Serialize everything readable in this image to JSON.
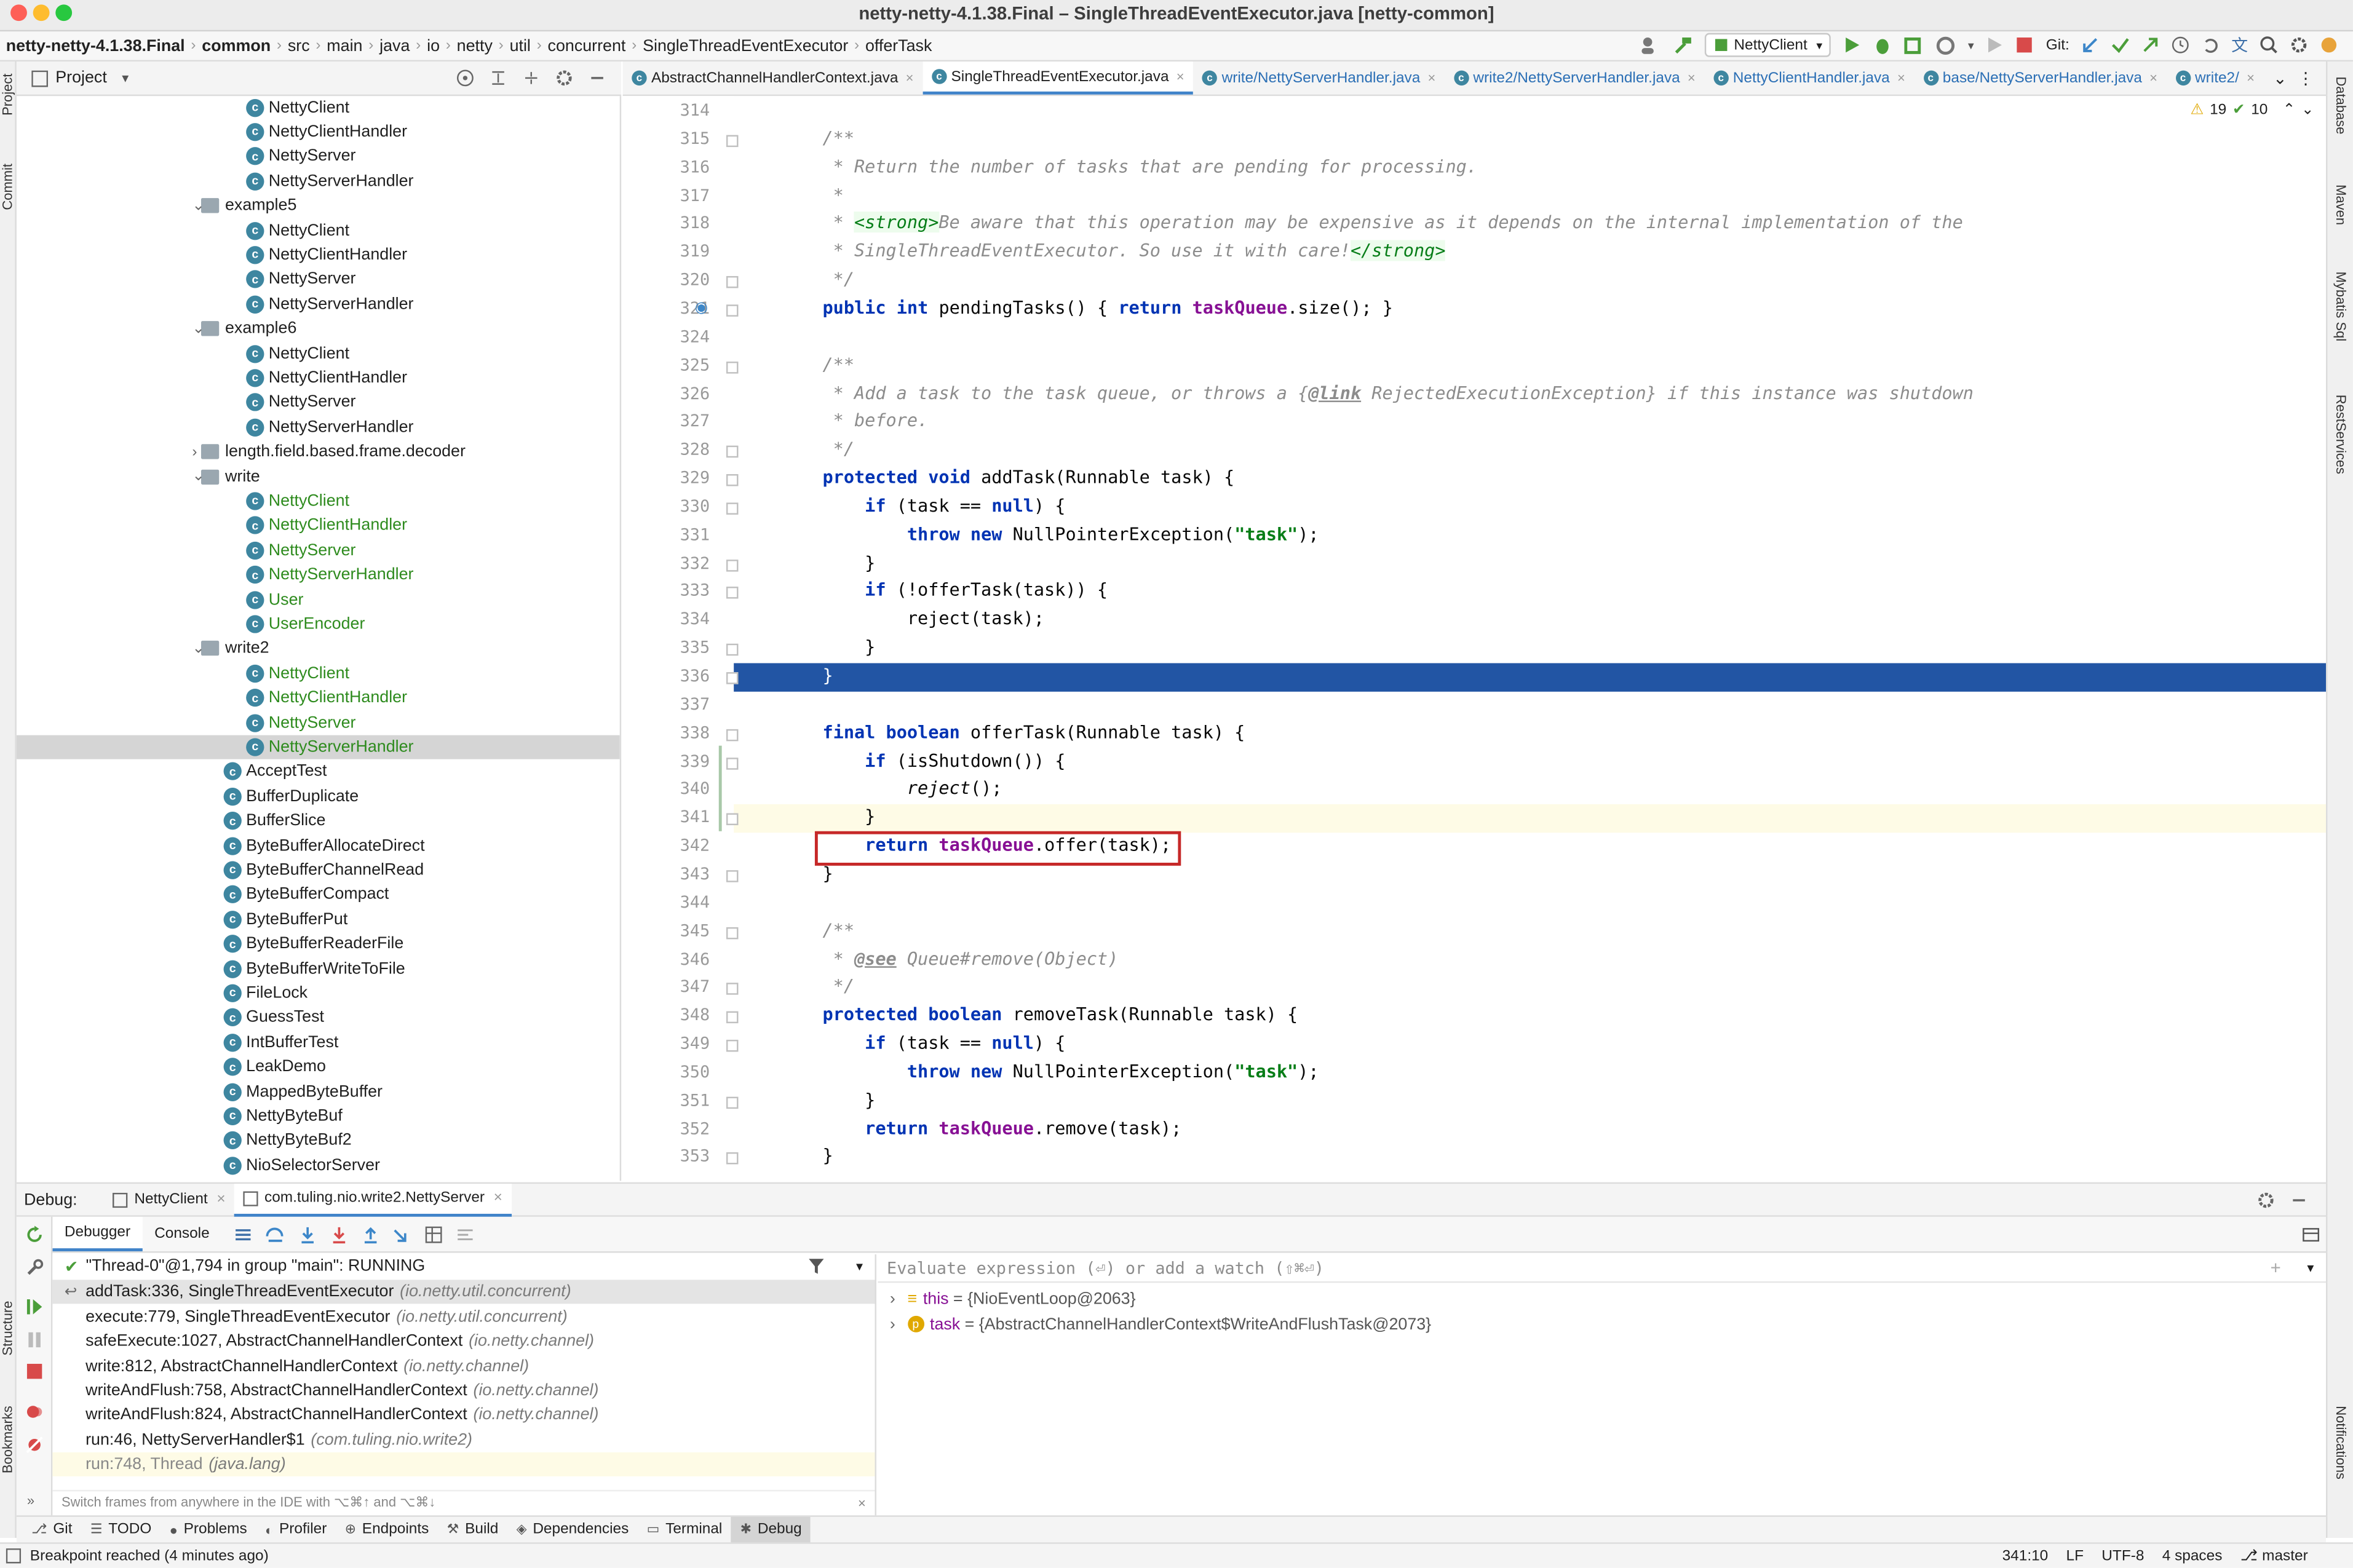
{
  "window_title": "netty-netty-4.1.38.Final – SingleThreadEventExecutor.java [netty-common]",
  "breadcrumbs": [
    "netty-netty-4.1.38.Final",
    "common",
    "src",
    "main",
    "java",
    "io",
    "netty",
    "util",
    "concurrent",
    "SingleThreadEventExecutor",
    "offerTask"
  ],
  "toolbar": {
    "run_config": "NettyClient",
    "git_label": "Git:"
  },
  "project_panel": {
    "title": "Project"
  },
  "tree": [
    {
      "label": "NettyClient",
      "level": 2,
      "kind": "class",
      "color": "normal"
    },
    {
      "label": "NettyClientHandler",
      "level": 2,
      "kind": "class",
      "color": "normal"
    },
    {
      "label": "NettyServer",
      "level": 2,
      "kind": "class",
      "color": "normal"
    },
    {
      "label": "NettyServerHandler",
      "level": 2,
      "kind": "class",
      "color": "normal"
    },
    {
      "label": "example5",
      "level": 1,
      "kind": "folder",
      "expanded": true
    },
    {
      "label": "NettyClient",
      "level": 2,
      "kind": "class",
      "color": "normal"
    },
    {
      "label": "NettyClientHandler",
      "level": 2,
      "kind": "class",
      "color": "normal"
    },
    {
      "label": "NettyServer",
      "level": 2,
      "kind": "class",
      "color": "normal"
    },
    {
      "label": "NettyServerHandler",
      "level": 2,
      "kind": "class",
      "color": "normal"
    },
    {
      "label": "example6",
      "level": 1,
      "kind": "folder",
      "expanded": true
    },
    {
      "label": "NettyClient",
      "level": 2,
      "kind": "class",
      "color": "normal"
    },
    {
      "label": "NettyClientHandler",
      "level": 2,
      "kind": "class",
      "color": "normal"
    },
    {
      "label": "NettyServer",
      "level": 2,
      "kind": "class",
      "color": "normal"
    },
    {
      "label": "NettyServerHandler",
      "level": 2,
      "kind": "class",
      "color": "normal"
    },
    {
      "label": "length.field.based.frame.decoder",
      "level": 1,
      "kind": "folder",
      "expanded": false
    },
    {
      "label": "write",
      "level": 1,
      "kind": "folder",
      "expanded": true
    },
    {
      "label": "NettyClient",
      "level": 2,
      "kind": "class",
      "color": "green"
    },
    {
      "label": "NettyClientHandler",
      "level": 2,
      "kind": "class",
      "color": "green"
    },
    {
      "label": "NettyServer",
      "level": 2,
      "kind": "class",
      "color": "green"
    },
    {
      "label": "NettyServerHandler",
      "level": 2,
      "kind": "class",
      "color": "green"
    },
    {
      "label": "User",
      "level": 2,
      "kind": "class",
      "color": "green"
    },
    {
      "label": "UserEncoder",
      "level": 2,
      "kind": "class",
      "color": "green"
    },
    {
      "label": "write2",
      "level": 1,
      "kind": "folder",
      "expanded": true
    },
    {
      "label": "NettyClient",
      "level": 2,
      "kind": "class",
      "color": "green"
    },
    {
      "label": "NettyClientHandler",
      "level": 2,
      "kind": "class",
      "color": "green"
    },
    {
      "label": "NettyServer",
      "level": 2,
      "kind": "class",
      "color": "green"
    },
    {
      "label": "NettyServerHandler",
      "level": 2,
      "kind": "class",
      "color": "green",
      "selected": true
    },
    {
      "label": "AcceptTest",
      "level": 1,
      "kind": "class",
      "color": "normal"
    },
    {
      "label": "BufferDuplicate",
      "level": 1,
      "kind": "class",
      "color": "normal"
    },
    {
      "label": "BufferSlice",
      "level": 1,
      "kind": "class",
      "color": "normal"
    },
    {
      "label": "ByteBufferAllocateDirect",
      "level": 1,
      "kind": "class",
      "color": "normal"
    },
    {
      "label": "ByteBufferChannelRead",
      "level": 1,
      "kind": "class",
      "color": "normal"
    },
    {
      "label": "ByteBufferCompact",
      "level": 1,
      "kind": "class",
      "color": "normal"
    },
    {
      "label": "ByteBufferPut",
      "level": 1,
      "kind": "class",
      "color": "normal"
    },
    {
      "label": "ByteBufferReaderFile",
      "level": 1,
      "kind": "class",
      "color": "normal"
    },
    {
      "label": "ByteBufferWriteToFile",
      "level": 1,
      "kind": "class",
      "color": "normal"
    },
    {
      "label": "FileLock",
      "level": 1,
      "kind": "class",
      "color": "normal"
    },
    {
      "label": "GuessTest",
      "level": 1,
      "kind": "class",
      "color": "normal"
    },
    {
      "label": "IntBufferTest",
      "level": 1,
      "kind": "class",
      "color": "normal"
    },
    {
      "label": "LeakDemo",
      "level": 1,
      "kind": "class",
      "color": "normal"
    },
    {
      "label": "MappedByteBuffer",
      "level": 1,
      "kind": "class",
      "color": "normal"
    },
    {
      "label": "NettyByteBuf",
      "level": 1,
      "kind": "class",
      "color": "normal"
    },
    {
      "label": "NettyByteBuf2",
      "level": 1,
      "kind": "class",
      "color": "normal"
    },
    {
      "label": "NioSelectorServer",
      "level": 1,
      "kind": "class",
      "color": "normal"
    }
  ],
  "editor_tabs": [
    {
      "label": "AbstractChannelHandlerContext.java",
      "active": false
    },
    {
      "label": "SingleThreadEventExecutor.java",
      "active": true
    },
    {
      "label": "write/NettyServerHandler.java",
      "active": false
    },
    {
      "label": "write2/NettyServerHandler.java",
      "active": false
    },
    {
      "label": "NettyClientHandler.java",
      "active": false
    },
    {
      "label": "base/NettyServerHandler.java",
      "active": false
    },
    {
      "label": "write2/",
      "active": false
    }
  ],
  "inspections": {
    "warnings": "19",
    "ok": "10"
  },
  "code_lines": [
    {
      "n": "314",
      "t": ""
    },
    {
      "n": "315",
      "t": "    /**"
    },
    {
      "n": "316",
      "t": "     * Return the number of tasks that are pending for processing."
    },
    {
      "n": "317",
      "t": "     *"
    },
    {
      "n": "318",
      "t": "     * <strong>Be aware that this operation may be expensive as it depends on the internal implementation of the"
    },
    {
      "n": "319",
      "t": "     * SingleThreadEventExecutor. So use it with care!</strong>"
    },
    {
      "n": "320",
      "t": "     */"
    },
    {
      "n": "321",
      "t": "    public int pendingTasks() { return taskQueue.size(); }"
    },
    {
      "n": "324",
      "t": ""
    },
    {
      "n": "325",
      "t": "    /**"
    },
    {
      "n": "326",
      "t": "     * Add a task to the task queue, or throws a {@link RejectedExecutionException} if this instance was shutdown"
    },
    {
      "n": "327",
      "t": "     * before."
    },
    {
      "n": "328",
      "t": "     */"
    },
    {
      "n": "329",
      "t": "    protected void addTask(Runnable task) {"
    },
    {
      "n": "330",
      "t": "        if (task == null) {"
    },
    {
      "n": "331",
      "t": "            throw new NullPointerException(\"task\");"
    },
    {
      "n": "332",
      "t": "        }"
    },
    {
      "n": "333",
      "t": "        if (!offerTask(task)) {"
    },
    {
      "n": "334",
      "t": "            reject(task);"
    },
    {
      "n": "335",
      "t": "        }"
    },
    {
      "n": "336",
      "t": "    }"
    },
    {
      "n": "337",
      "t": ""
    },
    {
      "n": "338",
      "t": "    final boolean offerTask(Runnable task) {"
    },
    {
      "n": "339",
      "t": "        if (isShutdown()) {"
    },
    {
      "n": "340",
      "t": "            reject();"
    },
    {
      "n": "341",
      "t": "        }"
    },
    {
      "n": "342",
      "t": "        return taskQueue.offer(task);"
    },
    {
      "n": "343",
      "t": "    }"
    },
    {
      "n": "344",
      "t": ""
    },
    {
      "n": "345",
      "t": "    /**"
    },
    {
      "n": "346",
      "t": "     * @see Queue#remove(Object)"
    },
    {
      "n": "347",
      "t": "     */"
    },
    {
      "n": "348",
      "t": "    protected boolean removeTask(Runnable task) {"
    },
    {
      "n": "349",
      "t": "        if (task == null) {"
    },
    {
      "n": "350",
      "t": "            throw new NullPointerException(\"task\");"
    },
    {
      "n": "351",
      "t": "        }"
    },
    {
      "n": "352",
      "t": "        return taskQueue.remove(task);"
    },
    {
      "n": "353",
      "t": "    }"
    }
  ],
  "debug": {
    "label": "Debug:",
    "sessions": [
      "NettyClient",
      "com.tuling.nio.write2.NettyServer"
    ],
    "tabs": [
      "Debugger",
      "Console"
    ],
    "thread": "\"Thread-0\"@1,794 in group \"main\": RUNNING",
    "frames": [
      {
        "m": "addTask:336, SingleThreadEventExecutor",
        "p": "(io.netty.util.concurrent)",
        "selected": true
      },
      {
        "m": "execute:779, SingleThreadEventExecutor",
        "p": "(io.netty.util.concurrent)"
      },
      {
        "m": "safeExecute:1027, AbstractChannelHandlerContext",
        "p": "(io.netty.channel)"
      },
      {
        "m": "write:812, AbstractChannelHandlerContext",
        "p": "(io.netty.channel)"
      },
      {
        "m": "writeAndFlush:758, AbstractChannelHandlerContext",
        "p": "(io.netty.channel)"
      },
      {
        "m": "writeAndFlush:824, AbstractChannelHandlerContext",
        "p": "(io.netty.channel)"
      },
      {
        "m": "run:46, NettyServerHandler$1",
        "p": "(com.tuling.nio.write2)"
      },
      {
        "m": "run:748, Thread",
        "p": "(java.lang)",
        "dim": true
      }
    ],
    "frames_hint": "Switch frames from anywhere in the IDE with ⌥⌘↑ and ⌥⌘↓",
    "eval_placeholder": "Evaluate expression (⏎) or add a watch (⇧⌘⏎)",
    "vars": [
      {
        "name": "this",
        "value": "= {NioEventLoop@2063}",
        "badge": "≡"
      },
      {
        "name": "task",
        "value": "= {AbstractChannelHandlerContext$WriteAndFlushTask@2073}",
        "badge": "p"
      }
    ]
  },
  "bottom_tools": [
    "Git",
    "TODO",
    "Problems",
    "Profiler",
    "Endpoints",
    "Build",
    "Dependencies",
    "Terminal",
    "Debug"
  ],
  "status": {
    "message": "Breakpoint reached (4 minutes ago)",
    "pos": "341:10",
    "eol": "LF",
    "enc": "UTF-8",
    "indent": "4 spaces",
    "branch": "master"
  },
  "left_strip": [
    "Project",
    "Commit",
    "Structure",
    "Bookmarks"
  ],
  "right_strip": [
    "Database",
    "Maven",
    "Mybatis Sql",
    "RestServices",
    "Notifications"
  ],
  "colors": {
    "exec_line": "#2255a4",
    "highlight_box": "#c62828",
    "current_line": "#fefbe6"
  }
}
